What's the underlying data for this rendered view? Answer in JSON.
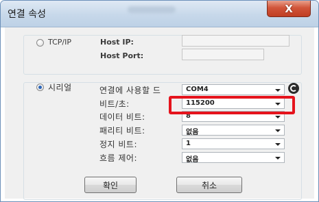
{
  "window": {
    "title": "연결 속성",
    "close_label": "X"
  },
  "tcp_group": {
    "radio_label": "TCP/IP",
    "selected": false,
    "host_ip_label": "Host IP:",
    "host_ip_value": "",
    "host_port_label": "Host Port:",
    "host_port_value": ""
  },
  "serial_group": {
    "radio_label": "시리얼",
    "selected": true,
    "fields": [
      {
        "label": "연결에 사용할 드",
        "value": "COM4"
      },
      {
        "label": "비트/초:",
        "value": "115200"
      },
      {
        "label": "데이터 비트:",
        "value": "8"
      },
      {
        "label": "패리티 비트:",
        "value": "없음"
      },
      {
        "label": "정지 비트:",
        "value": "1"
      },
      {
        "label": "흐름 제어:",
        "value": "없음"
      }
    ],
    "refresh_icon": "refresh-icon",
    "highlighted_field": "비트/초:"
  },
  "buttons": {
    "ok_label": "확인",
    "cancel_label": "취소"
  },
  "colors": {
    "highlight": "#e5131c",
    "radio_selected": "#2a64b8",
    "close_button": "#c03d22"
  }
}
